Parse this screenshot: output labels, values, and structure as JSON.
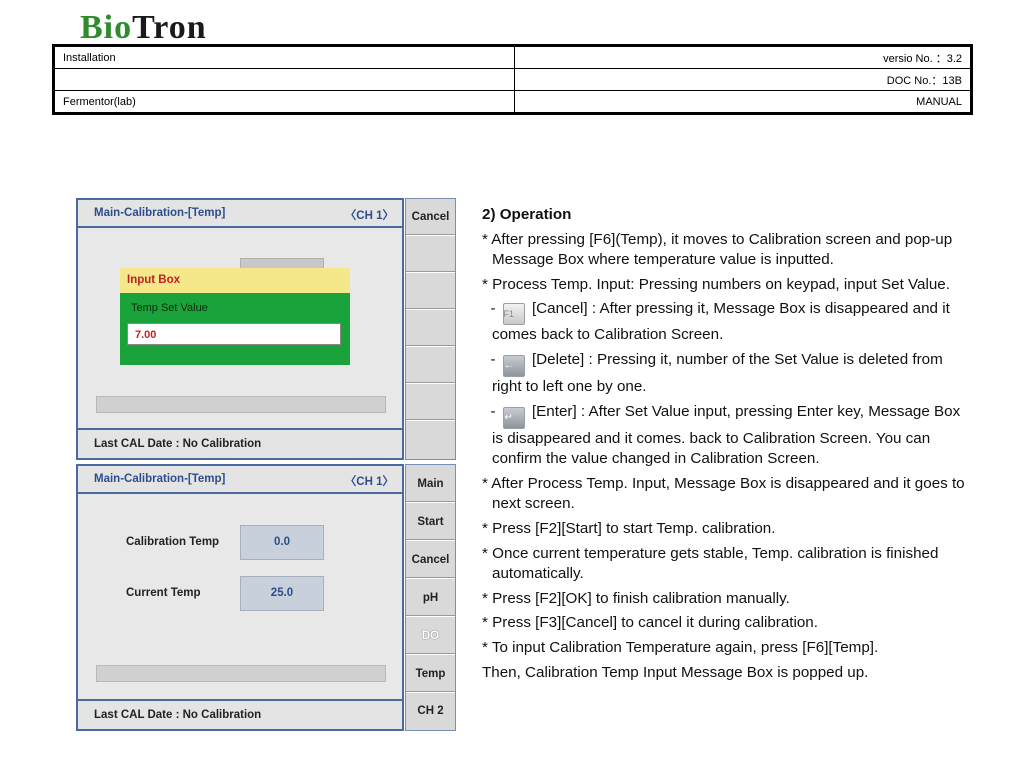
{
  "logo": {
    "part1": "Bio",
    "part2": "Tron"
  },
  "doc_header": {
    "r1_left": "Installation",
    "r1_right": "versio No. ：3.2",
    "r2_left": "",
    "r2_right": "DOC No.：13B",
    "r3_left": "Fermentor(lab)",
    "r3_right": "MANUAL"
  },
  "screen1": {
    "title": "Main-Calibration-[Temp]",
    "channel": "〈CH 1〉",
    "popup_header": "Input Box",
    "popup_label": "Temp Set Value",
    "popup_value": "7.00",
    "footer": "Last CAL Date : No Calibration",
    "softkeys": [
      "Cancel",
      "",
      "",
      "",
      "",
      "",
      ""
    ]
  },
  "screen2": {
    "title": "Main-Calibration-[Temp]",
    "channel": "〈CH 1〉",
    "calib_label": "Calibration Temp",
    "calib_value": "0.0",
    "current_label": "Current Temp",
    "current_value": "25.0",
    "footer": "Last CAL Date : No Calibration",
    "softkeys": [
      "Main",
      "Start",
      "Cancel",
      "pH",
      "DO",
      "Temp",
      "CH 2"
    ]
  },
  "key_icons": {
    "f1": "F1",
    "delete": "←",
    "enter": "↵"
  },
  "text": {
    "heading": "2) Operation",
    "p1": "*  After pressing [F6](Temp), it moves to Calibration screen and pop-up Message Box where temperature value is inputted.",
    "p2": "*  Process Temp. Input: Pressing numbers on keypad, input Set Value.",
    "b1_pre": "  - ",
    "b1_post": " [Cancel] : After pressing it, Message Box is disappeared and it comes back to Calibration Screen.",
    "b2_pre": "  - ",
    "b2_post": " [Delete] : Pressing it, number of the Set Value is deleted from right to left one by one.",
    "b3_pre": "  - ",
    "b3_post": " [Enter] : After Set Value input, pressing Enter key, Message Box is disappeared and it comes. back to Calibration Screen. You can confirm the value changed in Calibration Screen.",
    "p3": "* After Process Temp. Input, Message Box is disappeared and it goes to next screen.",
    "p4": "* Press [F2][Start] to start Temp. calibration.",
    "p5": "* Once current temperature gets stable, Temp. calibration is finished automatically.",
    "p6": "* Press [F2][OK] to finish calibration manually.",
    "p7": "* Press [F3][Cancel] to cancel it during calibration.",
    "p8": "* To input Calibration Temperature again, press [F6][Temp].",
    "p9": "Then, Calibration Temp Input Message Box is popped up."
  }
}
